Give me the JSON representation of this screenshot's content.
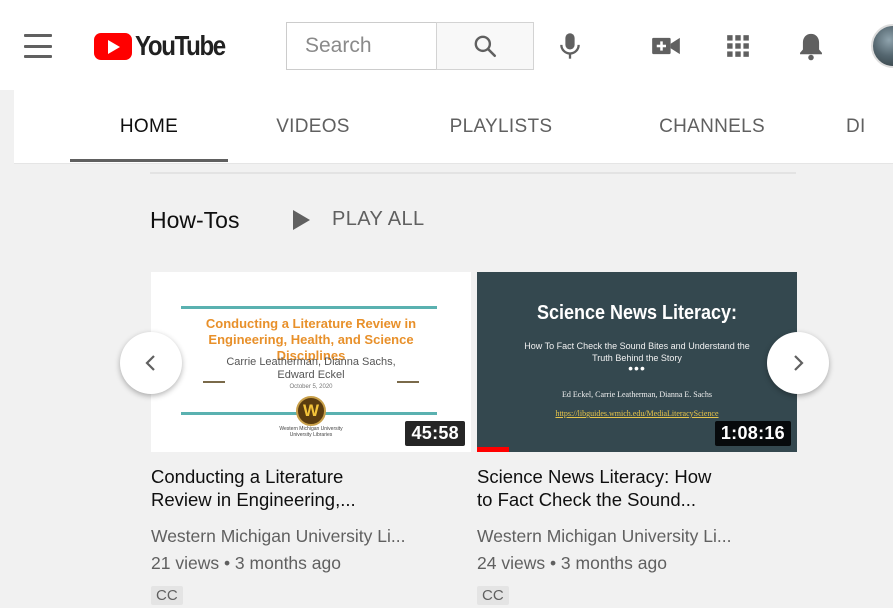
{
  "header": {
    "logo_text": "YouTube",
    "search_placeholder": "Search"
  },
  "tabs": [
    {
      "label": "HOME",
      "active": true
    },
    {
      "label": "VIDEOS",
      "active": false
    },
    {
      "label": "PLAYLISTS",
      "active": false
    },
    {
      "label": "CHANNELS",
      "active": false
    },
    {
      "label": "DI",
      "active": false
    }
  ],
  "shelf": {
    "title": "How-Tos",
    "play_all_label": "PLAY ALL"
  },
  "videos": [
    {
      "title_line1": "Conducting a Literature",
      "title_line2": "Review in Engineering,...",
      "channel": "Western Michigan University Li...",
      "meta": "21 views • 3 months ago",
      "badge": "CC",
      "duration": "45:58",
      "watched_fraction": 0,
      "thumbnail": {
        "title": "Conducting a Literature Review in Engineering, Health, and Science Disciplines",
        "authors": "Carrie Leatherman, Dianna Sachs, Edward Eckel",
        "date": "October 5, 2020",
        "seal_letter": "W",
        "university": "Western Michigan University",
        "department": "University Libraries"
      }
    },
    {
      "title_line1": "Science News Literacy: How",
      "title_line2": "to Fact Check the Sound...",
      "channel": "Western Michigan University Li...",
      "meta": "24 views • 3 months ago",
      "badge": "CC",
      "duration": "1:08:16",
      "watched_fraction": 0.1,
      "thumbnail": {
        "title": "Science News Literacy:",
        "subtitle": "How To Fact Check the Sound Bites and Understand the Truth Behind the Story",
        "dots": "•••",
        "authors": "Ed Eckel, Carrie Leatherman, Dianna E. Sachs",
        "url": "https://libguides.wmich.edu/MediaLiteracyScience"
      }
    }
  ],
  "colors": {
    "brand_red": "#ff0000",
    "icon_gray": "#606060",
    "accent_teal": "#5ab1b0",
    "accent_orange": "#e8902a"
  },
  "icons": {
    "menu": "hamburger-menu-icon",
    "search": "magnifier-icon",
    "mic": "microphone-icon",
    "create": "video-camera-plus-icon",
    "apps": "grid-apps-icon",
    "notifications": "bell-icon",
    "prev": "chevron-left-icon",
    "next": "chevron-right-icon",
    "play_all": "play-triangle-icon"
  }
}
